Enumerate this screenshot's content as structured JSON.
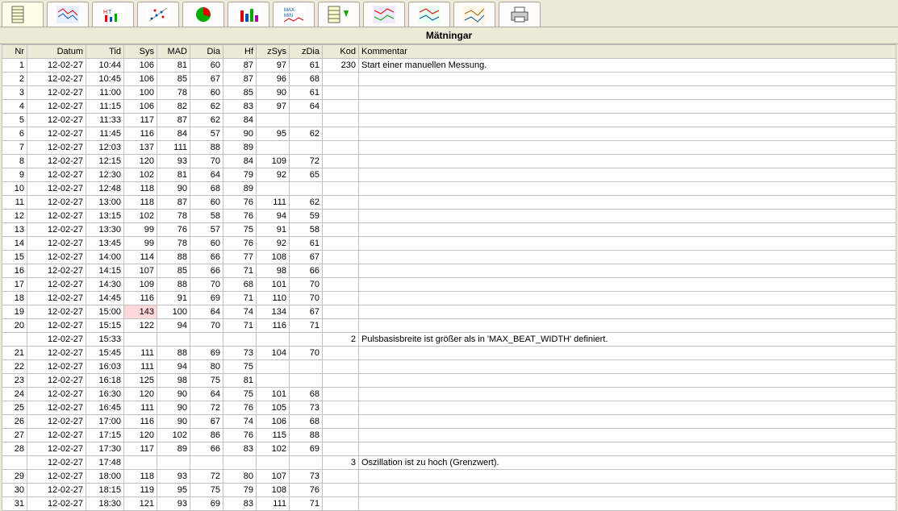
{
  "title": "Mätningar",
  "columns": [
    "Nr",
    "Datum",
    "Tid",
    "Sys",
    "MAD",
    "Dia",
    "Hf",
    "zSys",
    "zDia",
    "Kod",
    "Kommentar"
  ],
  "highlight": {
    "row_index": 18,
    "col": "Sys"
  },
  "toolbar": [
    {
      "name": "table-icon",
      "active": true
    },
    {
      "name": "chart-multi-icon",
      "active": false
    },
    {
      "name": "bars-stats-icon",
      "active": false
    },
    {
      "name": "scatter-icon",
      "active": false
    },
    {
      "name": "pie-icon",
      "active": false
    },
    {
      "name": "bar-chart-icon",
      "active": false
    },
    {
      "name": "max-min-icon",
      "active": false
    },
    {
      "name": "table-down-icon",
      "active": false
    },
    {
      "name": "chart-compare-a-icon",
      "active": false
    },
    {
      "name": "chart-compare-b-icon",
      "active": false
    },
    {
      "name": "chart-compare-c-icon",
      "active": false
    },
    {
      "name": "print-icon",
      "active": false
    }
  ],
  "rows": [
    {
      "Nr": "1",
      "Datum": "12-02-27",
      "Tid": "10:44",
      "Sys": "106",
      "MAD": "81",
      "Dia": "60",
      "Hf": "87",
      "zSys": "97",
      "zDia": "61",
      "Kod": "230",
      "Kommentar": "Start einer manuellen Messung."
    },
    {
      "Nr": "2",
      "Datum": "12-02-27",
      "Tid": "10:45",
      "Sys": "106",
      "MAD": "85",
      "Dia": "67",
      "Hf": "87",
      "zSys": "96",
      "zDia": "68",
      "Kod": "",
      "Kommentar": ""
    },
    {
      "Nr": "3",
      "Datum": "12-02-27",
      "Tid": "11:00",
      "Sys": "100",
      "MAD": "78",
      "Dia": "60",
      "Hf": "85",
      "zSys": "90",
      "zDia": "61",
      "Kod": "",
      "Kommentar": ""
    },
    {
      "Nr": "4",
      "Datum": "12-02-27",
      "Tid": "11:15",
      "Sys": "106",
      "MAD": "82",
      "Dia": "62",
      "Hf": "83",
      "zSys": "97",
      "zDia": "64",
      "Kod": "",
      "Kommentar": ""
    },
    {
      "Nr": "5",
      "Datum": "12-02-27",
      "Tid": "11:33",
      "Sys": "117",
      "MAD": "87",
      "Dia": "62",
      "Hf": "84",
      "zSys": "",
      "zDia": "",
      "Kod": "",
      "Kommentar": ""
    },
    {
      "Nr": "6",
      "Datum": "12-02-27",
      "Tid": "11:45",
      "Sys": "116",
      "MAD": "84",
      "Dia": "57",
      "Hf": "90",
      "zSys": "95",
      "zDia": "62",
      "Kod": "",
      "Kommentar": ""
    },
    {
      "Nr": "7",
      "Datum": "12-02-27",
      "Tid": "12:03",
      "Sys": "137",
      "MAD": "111",
      "Dia": "88",
      "Hf": "89",
      "zSys": "",
      "zDia": "",
      "Kod": "",
      "Kommentar": ""
    },
    {
      "Nr": "8",
      "Datum": "12-02-27",
      "Tid": "12:15",
      "Sys": "120",
      "MAD": "93",
      "Dia": "70",
      "Hf": "84",
      "zSys": "109",
      "zDia": "72",
      "Kod": "",
      "Kommentar": ""
    },
    {
      "Nr": "9",
      "Datum": "12-02-27",
      "Tid": "12:30",
      "Sys": "102",
      "MAD": "81",
      "Dia": "64",
      "Hf": "79",
      "zSys": "92",
      "zDia": "65",
      "Kod": "",
      "Kommentar": ""
    },
    {
      "Nr": "10",
      "Datum": "12-02-27",
      "Tid": "12:48",
      "Sys": "118",
      "MAD": "90",
      "Dia": "68",
      "Hf": "89",
      "zSys": "",
      "zDia": "",
      "Kod": "",
      "Kommentar": ""
    },
    {
      "Nr": "11",
      "Datum": "12-02-27",
      "Tid": "13:00",
      "Sys": "118",
      "MAD": "87",
      "Dia": "60",
      "Hf": "76",
      "zSys": "111",
      "zDia": "62",
      "Kod": "",
      "Kommentar": ""
    },
    {
      "Nr": "12",
      "Datum": "12-02-27",
      "Tid": "13:15",
      "Sys": "102",
      "MAD": "78",
      "Dia": "58",
      "Hf": "76",
      "zSys": "94",
      "zDia": "59",
      "Kod": "",
      "Kommentar": ""
    },
    {
      "Nr": "13",
      "Datum": "12-02-27",
      "Tid": "13:30",
      "Sys": "99",
      "MAD": "76",
      "Dia": "57",
      "Hf": "75",
      "zSys": "91",
      "zDia": "58",
      "Kod": "",
      "Kommentar": ""
    },
    {
      "Nr": "14",
      "Datum": "12-02-27",
      "Tid": "13:45",
      "Sys": "99",
      "MAD": "78",
      "Dia": "60",
      "Hf": "76",
      "zSys": "92",
      "zDia": "61",
      "Kod": "",
      "Kommentar": ""
    },
    {
      "Nr": "15",
      "Datum": "12-02-27",
      "Tid": "14:00",
      "Sys": "114",
      "MAD": "88",
      "Dia": "66",
      "Hf": "77",
      "zSys": "108",
      "zDia": "67",
      "Kod": "",
      "Kommentar": ""
    },
    {
      "Nr": "16",
      "Datum": "12-02-27",
      "Tid": "14:15",
      "Sys": "107",
      "MAD": "85",
      "Dia": "66",
      "Hf": "71",
      "zSys": "98",
      "zDia": "66",
      "Kod": "",
      "Kommentar": ""
    },
    {
      "Nr": "17",
      "Datum": "12-02-27",
      "Tid": "14:30",
      "Sys": "109",
      "MAD": "88",
      "Dia": "70",
      "Hf": "68",
      "zSys": "101",
      "zDia": "70",
      "Kod": "",
      "Kommentar": ""
    },
    {
      "Nr": "18",
      "Datum": "12-02-27",
      "Tid": "14:45",
      "Sys": "116",
      "MAD": "91",
      "Dia": "69",
      "Hf": "71",
      "zSys": "110",
      "zDia": "70",
      "Kod": "",
      "Kommentar": ""
    },
    {
      "Nr": "19",
      "Datum": "12-02-27",
      "Tid": "15:00",
      "Sys": "143",
      "MAD": "100",
      "Dia": "64",
      "Hf": "74",
      "zSys": "134",
      "zDia": "67",
      "Kod": "",
      "Kommentar": ""
    },
    {
      "Nr": "20",
      "Datum": "12-02-27",
      "Tid": "15:15",
      "Sys": "122",
      "MAD": "94",
      "Dia": "70",
      "Hf": "71",
      "zSys": "116",
      "zDia": "71",
      "Kod": "",
      "Kommentar": ""
    },
    {
      "Nr": "",
      "Datum": "12-02-27",
      "Tid": "15:33",
      "Sys": "",
      "MAD": "",
      "Dia": "",
      "Hf": "",
      "zSys": "",
      "zDia": "",
      "Kod": "2",
      "Kommentar": "Pulsbasisbreite ist größer als in 'MAX_BEAT_WIDTH' definiert."
    },
    {
      "Nr": "21",
      "Datum": "12-02-27",
      "Tid": "15:45",
      "Sys": "111",
      "MAD": "88",
      "Dia": "69",
      "Hf": "73",
      "zSys": "104",
      "zDia": "70",
      "Kod": "",
      "Kommentar": ""
    },
    {
      "Nr": "22",
      "Datum": "12-02-27",
      "Tid": "16:03",
      "Sys": "111",
      "MAD": "94",
      "Dia": "80",
      "Hf": "75",
      "zSys": "",
      "zDia": "",
      "Kod": "",
      "Kommentar": ""
    },
    {
      "Nr": "23",
      "Datum": "12-02-27",
      "Tid": "16:18",
      "Sys": "125",
      "MAD": "98",
      "Dia": "75",
      "Hf": "81",
      "zSys": "",
      "zDia": "",
      "Kod": "",
      "Kommentar": ""
    },
    {
      "Nr": "24",
      "Datum": "12-02-27",
      "Tid": "16:30",
      "Sys": "120",
      "MAD": "90",
      "Dia": "64",
      "Hf": "75",
      "zSys": "101",
      "zDia": "68",
      "Kod": "",
      "Kommentar": ""
    },
    {
      "Nr": "25",
      "Datum": "12-02-27",
      "Tid": "16:45",
      "Sys": "111",
      "MAD": "90",
      "Dia": "72",
      "Hf": "76",
      "zSys": "105",
      "zDia": "73",
      "Kod": "",
      "Kommentar": ""
    },
    {
      "Nr": "26",
      "Datum": "12-02-27",
      "Tid": "17:00",
      "Sys": "116",
      "MAD": "90",
      "Dia": "67",
      "Hf": "74",
      "zSys": "106",
      "zDia": "68",
      "Kod": "",
      "Kommentar": ""
    },
    {
      "Nr": "27",
      "Datum": "12-02-27",
      "Tid": "17:15",
      "Sys": "120",
      "MAD": "102",
      "Dia": "86",
      "Hf": "76",
      "zSys": "115",
      "zDia": "88",
      "Kod": "",
      "Kommentar": ""
    },
    {
      "Nr": "28",
      "Datum": "12-02-27",
      "Tid": "17:30",
      "Sys": "117",
      "MAD": "89",
      "Dia": "66",
      "Hf": "83",
      "zSys": "102",
      "zDia": "69",
      "Kod": "",
      "Kommentar": ""
    },
    {
      "Nr": "",
      "Datum": "12-02-27",
      "Tid": "17:48",
      "Sys": "",
      "MAD": "",
      "Dia": "",
      "Hf": "",
      "zSys": "",
      "zDia": "",
      "Kod": "3",
      "Kommentar": "Oszillation ist zu hoch (Grenzwert)."
    },
    {
      "Nr": "29",
      "Datum": "12-02-27",
      "Tid": "18:00",
      "Sys": "118",
      "MAD": "93",
      "Dia": "72",
      "Hf": "80",
      "zSys": "107",
      "zDia": "73",
      "Kod": "",
      "Kommentar": ""
    },
    {
      "Nr": "30",
      "Datum": "12-02-27",
      "Tid": "18:15",
      "Sys": "119",
      "MAD": "95",
      "Dia": "75",
      "Hf": "79",
      "zSys": "108",
      "zDia": "76",
      "Kod": "",
      "Kommentar": ""
    },
    {
      "Nr": "31",
      "Datum": "12-02-27",
      "Tid": "18:30",
      "Sys": "121",
      "MAD": "93",
      "Dia": "69",
      "Hf": "83",
      "zSys": "111",
      "zDia": "71",
      "Kod": "",
      "Kommentar": ""
    }
  ]
}
